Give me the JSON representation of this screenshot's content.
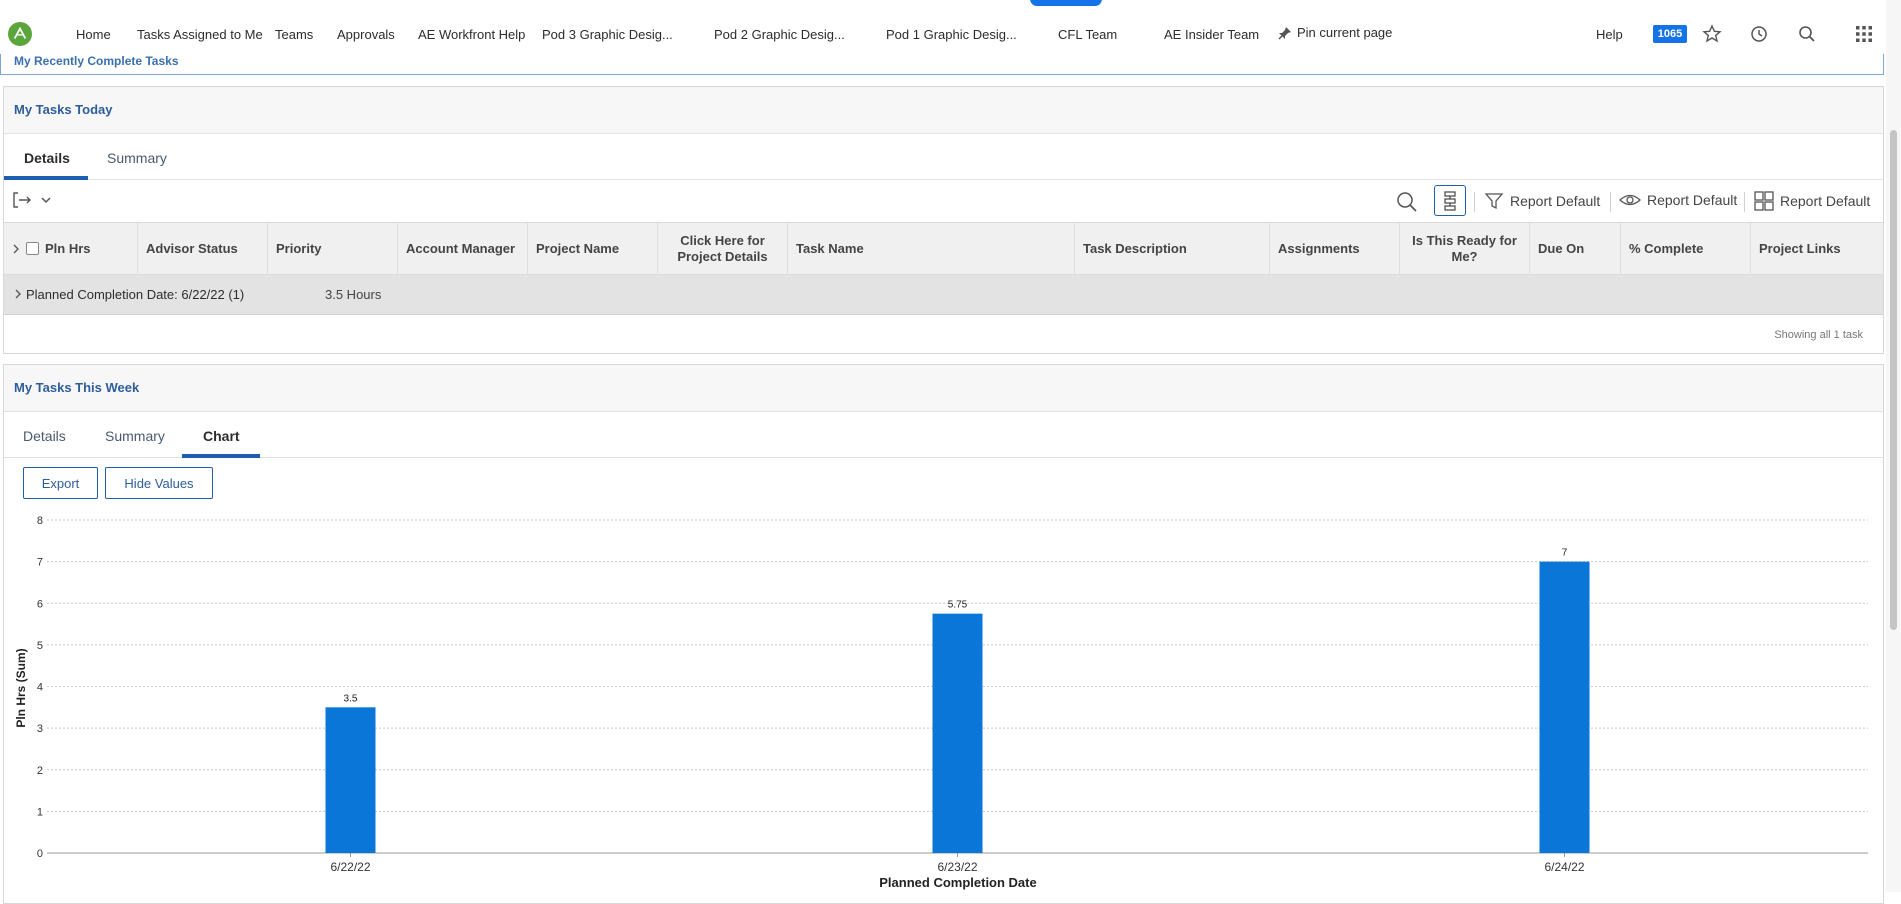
{
  "nav": {
    "items": [
      "Home",
      "Tasks Assigned to Me",
      "Teams",
      "Approvals",
      "AE Workfront Help",
      "Pod 3 Graphic Desig...",
      "Pod 2 Graphic Desig...",
      "Pod 1 Graphic Desig...",
      "CFL Team",
      "AE Insider Team"
    ],
    "pin_label": "Pin current page",
    "help": "Help",
    "badge": "1065"
  },
  "recent_title": "My Recently Complete Tasks",
  "today": {
    "title": "My Tasks Today",
    "tabs": [
      "Details",
      "Summary"
    ],
    "toolbar": {
      "filter": "Report Default",
      "view": "Report Default",
      "grouping": "Report Default"
    },
    "columns": [
      "Pln Hrs",
      "Advisor Status",
      "Priority",
      "Account Manager",
      "Project Name",
      "Click Here for Project Details",
      "Task Name",
      "Task Description",
      "Assignments",
      "Is This Ready for Me?",
      "Due On",
      "% Complete",
      "Project Links"
    ],
    "group_label": "Planned Completion Date: 6/22/22 (1)",
    "group_value": "3.5 Hours",
    "showing": "Showing all 1 task"
  },
  "week": {
    "title": "My Tasks This Week",
    "tabs": [
      "Details",
      "Summary",
      "Chart"
    ],
    "export": "Export",
    "hide_values": "Hide Values"
  },
  "colors": {
    "accent": "#1b5fae",
    "bar": "#0a76d8",
    "logo": "#5aa53c"
  },
  "chart_data": {
    "type": "bar",
    "categories": [
      "6/22/22",
      "6/23/22",
      "6/24/22"
    ],
    "values": [
      3.5,
      5.75,
      7
    ],
    "value_labels": [
      "3.5",
      "5.75",
      "7"
    ],
    "xlabel": "Planned Completion Date",
    "ylabel": "Pln Hrs (Sum)",
    "ylim": [
      0,
      8
    ],
    "yticks": [
      "0",
      "1",
      "2",
      "3",
      "4",
      "5",
      "6",
      "7",
      "8"
    ],
    "grid": true
  }
}
